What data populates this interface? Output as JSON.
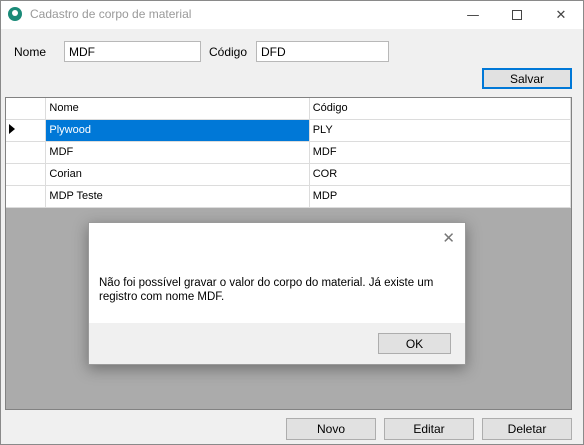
{
  "window": {
    "title": "Cadastro de corpo de material",
    "minimize_glyph": "—",
    "close_glyph": "✕"
  },
  "form": {
    "nome_label": "Nome",
    "nome_value": "MDF",
    "codigo_label": "Código",
    "codigo_value": "DFD",
    "save_label": "Salvar"
  },
  "grid": {
    "columns": [
      "Nome",
      "Código"
    ],
    "rows": [
      {
        "nome": "Plywood",
        "codigo": "PLY",
        "selected": true
      },
      {
        "nome": "MDF",
        "codigo": "MDF",
        "selected": false
      },
      {
        "nome": "Corian",
        "codigo": "COR",
        "selected": false
      },
      {
        "nome": "MDP Teste",
        "codigo": "MDP",
        "selected": false
      }
    ]
  },
  "dialog": {
    "message": "Não foi possível gravar o valor do corpo do material. Já existe um registro com nome MDF.",
    "ok_label": "OK",
    "close_glyph": "✕"
  },
  "footer": {
    "novo_label": "Novo",
    "editar_label": "Editar",
    "deletar_label": "Deletar"
  }
}
